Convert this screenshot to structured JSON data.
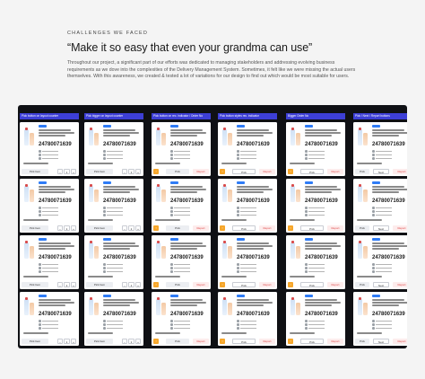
{
  "section": {
    "eyebrow": "CHALLENGES WE FACED",
    "headline": "“Make it so easy that even your grandma can use”",
    "body": "Throughout our project, a significant part of our efforts was dedicated to managing stakeholders and addressing evolving business requirements as we dove into the complexities of the Delivery Management System. Sometimes, it felt like we were missing the actual users themselves. With this awareness, we created & tested a lot of variations for our design to find out which would be most suitable for users."
  },
  "board": {
    "columns": [
      {
        "header": "Pick button on layout counter",
        "variant": "qty",
        "primary": "Pick Item",
        "qty_value": "1"
      },
      {
        "header": "Pick bigger on layout counter",
        "variant": "qty",
        "primary": "Pick Item",
        "qty_value": "1"
      },
      {
        "header": "Pick button on rec. indicator / Order No",
        "variant": "pick",
        "primary": "Pick",
        "secondary": "Report"
      },
      {
        "header": "Pick button styles rec. indicator",
        "variant": "pick",
        "primary": "Pick",
        "secondary": "Report"
      },
      {
        "header": "Bigger Order No",
        "variant": "pick",
        "primary": "Pick",
        "secondary": "Report"
      },
      {
        "header": "Pick / Next / Report buttons",
        "variant": "three",
        "primary": "Pick",
        "secondary": "Next",
        "tertiary": "Report"
      }
    ],
    "card": {
      "order_number": "24780071639"
    }
  },
  "colors": {
    "board_bg": "#0f1014",
    "accent": "#3d3fd6",
    "tag": "#2f7cf6",
    "warning": "#f6a62a"
  }
}
